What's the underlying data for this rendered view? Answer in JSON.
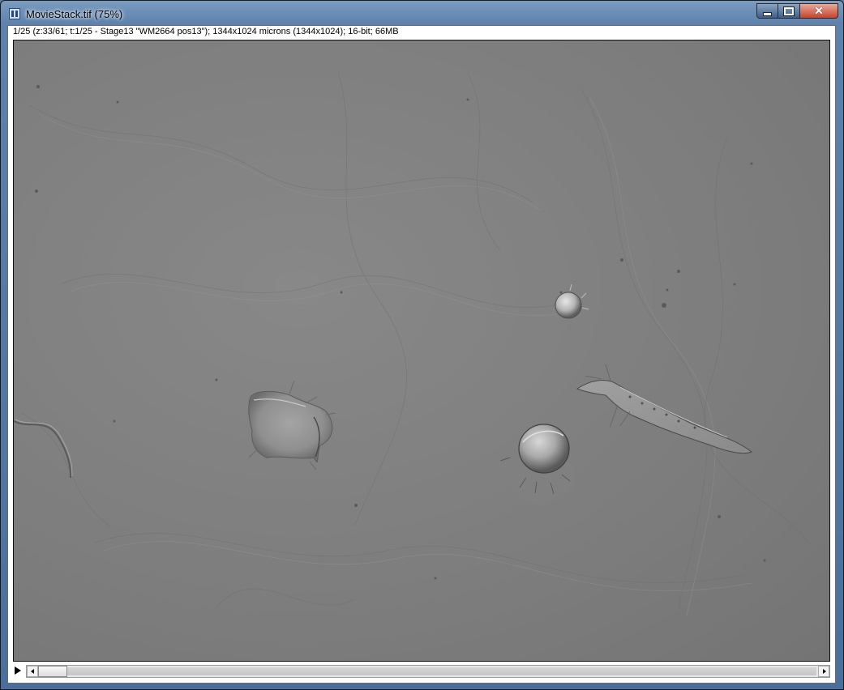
{
  "window": {
    "title": "MovieStack.tif (75%)",
    "info_line": "1/25 (z:33/61; t:1/25 - Stage13 \"WM2664 pos13\"); 1344x1024 microns (1344x1024); 16-bit; 66MB",
    "controls": {
      "minimize_icon": "minimize-icon",
      "maximize_icon": "maximize-icon",
      "close_icon": "close-icon",
      "close_glyph": "✕"
    }
  },
  "image": {
    "description_icon": "microscopy-image",
    "accent_colors": {
      "background_gray": "#7d7d7d",
      "highlight": "#d8d8d8",
      "shadow": "#3e3e3e"
    }
  },
  "scrollbar": {
    "play_icon": "play-icon",
    "left_arrow_icon": "arrow-left-icon",
    "right_arrow_icon": "arrow-right-icon",
    "position_fraction": 0.0
  }
}
